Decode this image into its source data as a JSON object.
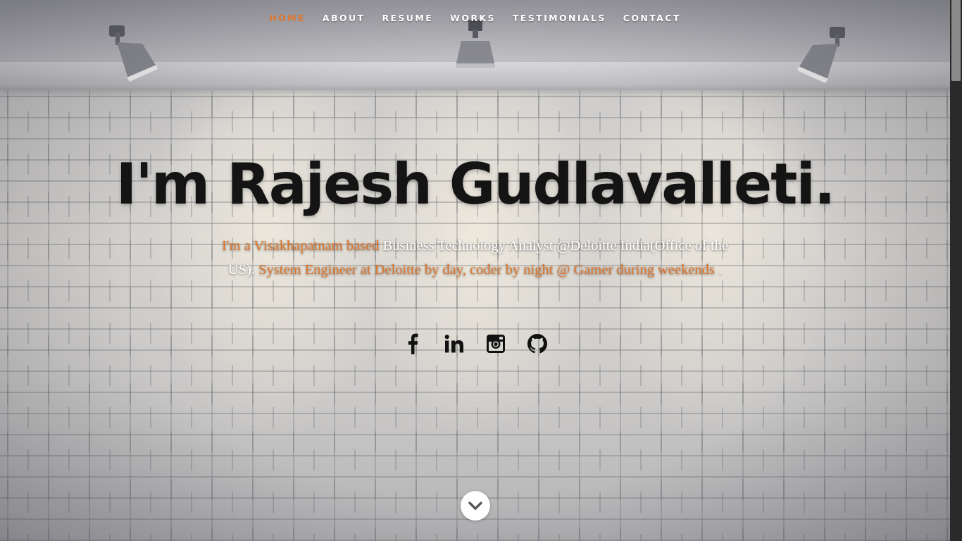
{
  "nav": {
    "items": [
      {
        "label": "HOME",
        "active": true
      },
      {
        "label": "ABOUT",
        "active": false
      },
      {
        "label": "RESUME",
        "active": false
      },
      {
        "label": "WORKS",
        "active": false
      },
      {
        "label": "TESTIMONIALS",
        "active": false
      },
      {
        "label": "CONTACT",
        "active": false
      }
    ]
  },
  "hero": {
    "title": "I'm Rajesh Gudlavalleti.",
    "intro": {
      "part1": "I'm a Visakhapatnam based",
      "part2": " Business Technology Analyst @Deloitte India(Office of the US). ",
      "part3": "System Engineer at Deloitte by day, coder by night @ Gamer during weekends",
      "part4": " ."
    }
  },
  "social": [
    {
      "icon": "facebook-icon"
    },
    {
      "icon": "linkedin-icon"
    },
    {
      "icon": "instagram-icon"
    },
    {
      "icon": "github-icon"
    }
  ],
  "scroll_down": {
    "icon": "chevron-down-icon"
  },
  "colors": {
    "accent": "#e0762b",
    "title": "#141414",
    "text": "#ffffff"
  }
}
